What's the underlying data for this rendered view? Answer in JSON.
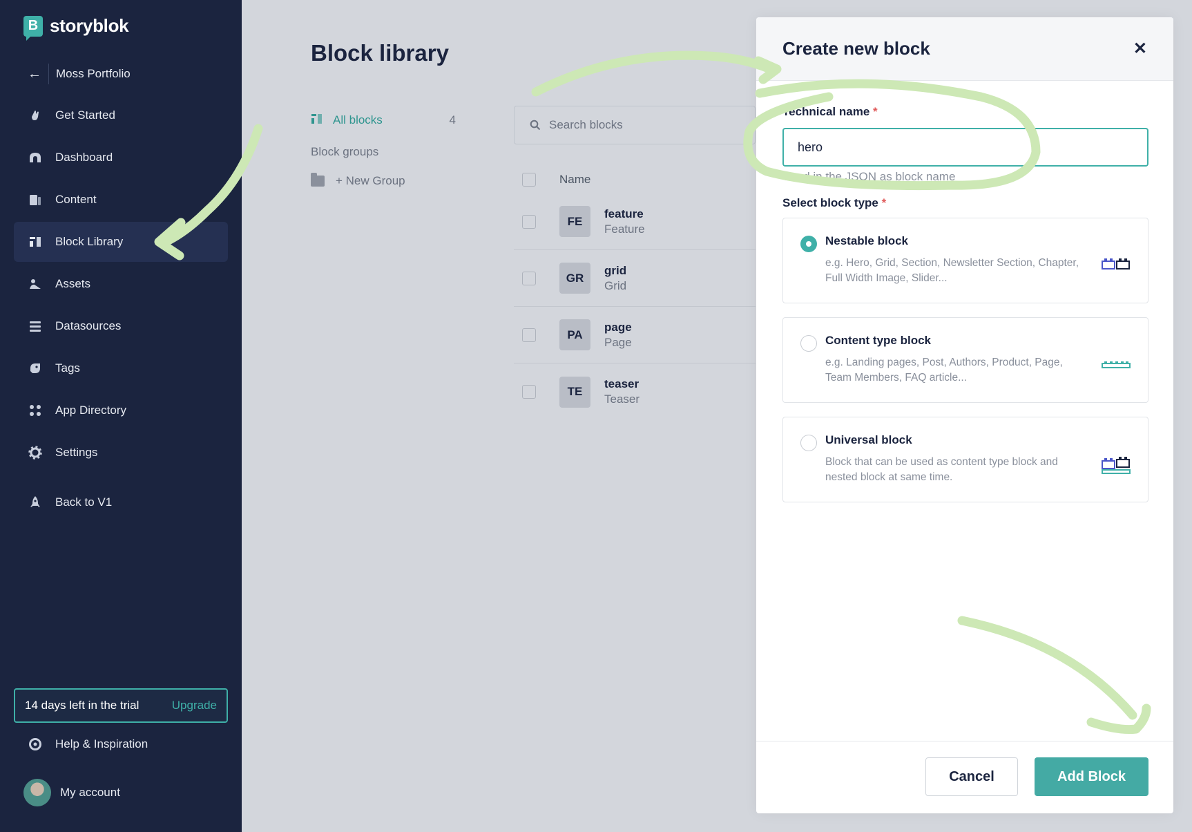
{
  "brand": {
    "name": "storyblok",
    "mark": "B"
  },
  "space": {
    "name": "Moss Portfolio"
  },
  "nav": [
    {
      "label": "Get Started",
      "icon": "hand-wave-icon"
    },
    {
      "label": "Dashboard",
      "icon": "dashboard-icon"
    },
    {
      "label": "Content",
      "icon": "content-icon"
    },
    {
      "label": "Block Library",
      "icon": "block-library-icon",
      "active": true
    },
    {
      "label": "Assets",
      "icon": "assets-icon"
    },
    {
      "label": "Datasources",
      "icon": "datasources-icon"
    },
    {
      "label": "Tags",
      "icon": "tag-icon"
    },
    {
      "label": "App Directory",
      "icon": "app-directory-icon"
    },
    {
      "label": "Settings",
      "icon": "gear-icon"
    },
    {
      "label": "Back to V1",
      "icon": "rocket-icon"
    }
  ],
  "trial": {
    "text": "14 days left in the trial",
    "upgrade": "Upgrade"
  },
  "footer": {
    "help": "Help & Inspiration",
    "account": "My account"
  },
  "main": {
    "title": "Block library",
    "filters": {
      "all_label": "All blocks",
      "all_count": "4",
      "groups_label": "Block groups",
      "new_group": "+ New Group"
    },
    "search_placeholder": "Search blocks",
    "column_name": "Name",
    "blocks": [
      {
        "badge": "FE",
        "name": "feature",
        "display": "Feature"
      },
      {
        "badge": "GR",
        "name": "grid",
        "display": "Grid"
      },
      {
        "badge": "PA",
        "name": "page",
        "display": "Page"
      },
      {
        "badge": "TE",
        "name": "teaser",
        "display": "Teaser"
      }
    ]
  },
  "dialog": {
    "title": "Create new block",
    "technical_name_label": "Technical name",
    "required_mark": "*",
    "technical_name_value": "hero",
    "technical_name_hint": "Used in the JSON as block name",
    "block_type_label": "Select block type",
    "types": [
      {
        "name": "Nestable block",
        "desc": "e.g. Hero, Grid, Section, Newsletter Section, Chapter, Full Width Image, Slider...",
        "selected": true
      },
      {
        "name": "Content type block",
        "desc": "e.g. Landing pages, Post, Authors, Product, Page, Team Members, FAQ article...",
        "selected": false
      },
      {
        "name": "Universal block",
        "desc": "Block that can be used as content type block and nested block at same time.",
        "selected": false
      }
    ],
    "cancel": "Cancel",
    "add": "Add Block"
  },
  "colors": {
    "sidebar": "#1b243f",
    "accent": "#3fb0a8",
    "annotation": "#cde8b5"
  }
}
